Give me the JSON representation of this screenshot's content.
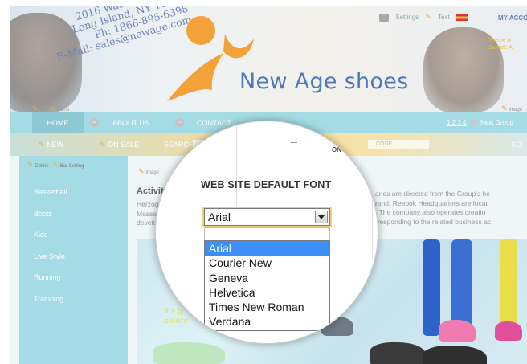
{
  "header": {
    "address_lines": [
      "2016 Washington Ave",
      "Long Island, NY 10698",
      "Ph: 1866-895-6398",
      "E-Mail: sales@newage.com"
    ],
    "brand_name": "New Age shoes",
    "top_links": {
      "settings": "Settings",
      "text": "Text",
      "account": "MY ACCO"
    },
    "theme_links": [
      "Theme A",
      "Sample A"
    ],
    "edit_left": [
      "Text",
      "Menu"
    ],
    "edit_right": "Image"
  },
  "nav": {
    "items": [
      "HOME",
      "ABOUT US",
      "CONTACT"
    ],
    "pager": {
      "pages": "1 2 3 4",
      "next": "Next Group"
    }
  },
  "subnav": {
    "items": [
      "NEW",
      "ON SALE",
      "SEARCH"
    ],
    "code_text": "CODE",
    "right_text": "SO"
  },
  "sidebar": {
    "edit_links": [
      "Colors",
      "Bar Setting"
    ],
    "items": [
      "Basketball",
      "Boots",
      "Kids",
      "Live Style",
      "Running",
      "Trainning"
    ]
  },
  "main": {
    "edit_link": "Image",
    "heading": "Activiti",
    "para_left": [
      "Herzog",
      "Massa",
      "develo"
    ],
    "para_right": [
      "aries are directed from the Group's he",
      "rand. Reebok Headquarters are locat",
      ". The company also operates creatio",
      "rresponding to the related business ac"
    ],
    "banner_text": [
      "It's g",
      "colors"
    ]
  },
  "font_dialog": {
    "fragment_label": "ONT",
    "title": "WEB SITE DEFAULT FONT",
    "selected": "Arial",
    "options": [
      "Arial",
      "Courier New",
      "Geneva",
      "Helvetica",
      "Times New Roman",
      "Verdana"
    ],
    "highlighted_index": 0
  },
  "colors": {
    "accent_blue": "#3b8ff6",
    "nav_teal": "#a5dbe4",
    "logo_orange": "#f3a23a",
    "brand_blue": "#4f79b8"
  },
  "icons": {
    "edit": "pencil-icon",
    "collapse": "minus-circle-icon",
    "dropdown": "chevron-down-icon",
    "settings": "search-icon",
    "flag": "flag-icon"
  }
}
